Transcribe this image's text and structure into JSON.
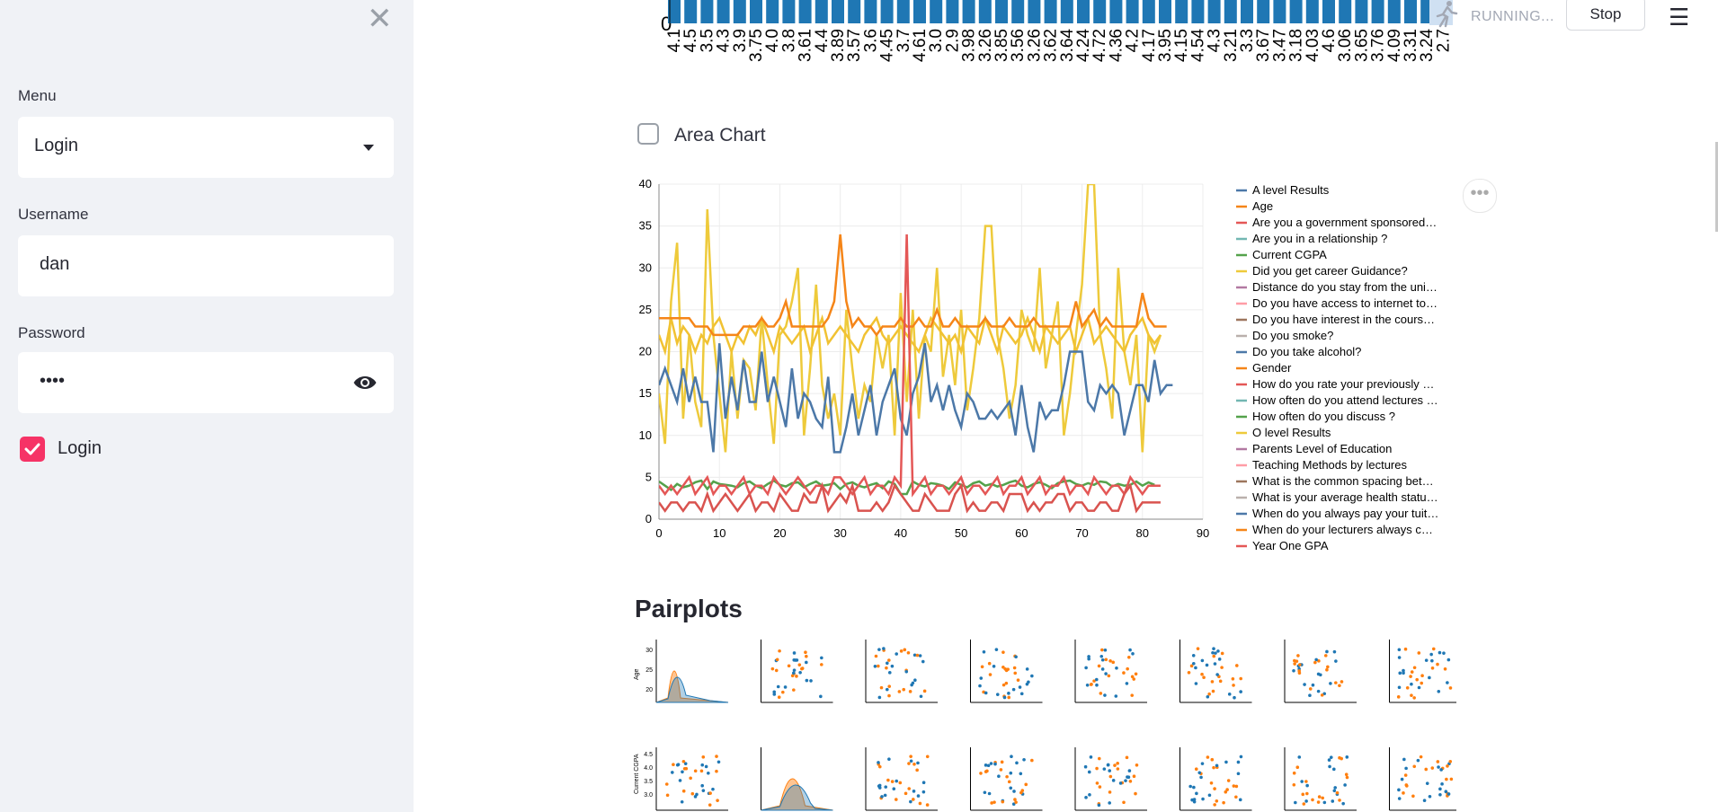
{
  "sidebar": {
    "close_icon": "close-icon",
    "menu_label": "Menu",
    "menu_value": "Login",
    "username_label": "Username",
    "username_value": "dan",
    "password_label": "Password",
    "password_masked": "••••",
    "login_checkbox_label": "Login",
    "login_checked": true,
    "accent_color": "#f63366"
  },
  "top_bar": {
    "status_text": "RUNNING...",
    "stop_label": "Stop",
    "menu_icon": "hamburger-icon"
  },
  "bar_chart_fragment": {
    "y_tick_zero": "0",
    "x_tick_labels": [
      "4.1",
      "4.5",
      "3.5",
      "4.3",
      "3.9",
      "3.75",
      "4.0",
      "3.8",
      "3.61",
      "4.4",
      "3.89",
      "3.57",
      "3.6",
      "4.45",
      "3.7",
      "4.61",
      "3.0",
      "2.9",
      "3.98",
      "3.26",
      "3.85",
      "3.56",
      "3.26",
      "3.62",
      "3.64",
      "4.24",
      "4.72",
      "4.36",
      "4.2",
      "4.17",
      "3.95",
      "4.15",
      "4.54",
      "4.3",
      "3.21",
      "3.3",
      "3.67",
      "3.47",
      "3.18",
      "4.03",
      "4.6",
      "3.06",
      "3.65",
      "3.76",
      "4.09",
      "3.31",
      "3.24",
      "2.7"
    ]
  },
  "area_chart": {
    "checkbox_label": "Area Chart",
    "checked": false
  },
  "chart_data": {
    "type": "line",
    "x_range": [
      0,
      90
    ],
    "y_range": [
      0,
      40
    ],
    "x_ticks": [
      0,
      10,
      20,
      30,
      40,
      50,
      60,
      70,
      80,
      90
    ],
    "y_ticks": [
      0,
      5,
      10,
      15,
      20,
      25,
      30,
      35,
      40
    ],
    "legend": [
      {
        "name": "A level Results",
        "color": "#4c78a8"
      },
      {
        "name": "Age",
        "color": "#f58518"
      },
      {
        "name": "Are you a government sponsored…",
        "color": "#e45756"
      },
      {
        "name": "Are you in a relationship ?",
        "color": "#72b7b2"
      },
      {
        "name": "Current CGPA",
        "color": "#54a24b"
      },
      {
        "name": "Did you get career Guidance?",
        "color": "#eeca3b"
      },
      {
        "name": "Distance do you stay from the uni…",
        "color": "#b279a2"
      },
      {
        "name": "Do you have access to internet to…",
        "color": "#ff9da6"
      },
      {
        "name": "Do you have interest in the cours…",
        "color": "#9d755d"
      },
      {
        "name": "Do you smoke?",
        "color": "#bab0ac"
      },
      {
        "name": "Do you take alcohol?",
        "color": "#4c78a8"
      },
      {
        "name": "Gender",
        "color": "#f58518"
      },
      {
        "name": "How do you rate your previously …",
        "color": "#e45756"
      },
      {
        "name": "How often do you attend lectures …",
        "color": "#72b7b2"
      },
      {
        "name": "How often do you discuss ?",
        "color": "#54a24b"
      },
      {
        "name": "O level Results",
        "color": "#eeca3b"
      },
      {
        "name": "Parents Level of Education",
        "color": "#b279a2"
      },
      {
        "name": "Teaching Methods by lectures",
        "color": "#ff9da6"
      },
      {
        "name": "What is the common spacing bet…",
        "color": "#9d755d"
      },
      {
        "name": "What is your average health statu…",
        "color": "#bab0ac"
      },
      {
        "name": "When do you always pay your tuit…",
        "color": "#4c78a8"
      },
      {
        "name": "When do your lecturers always c…",
        "color": "#f58518"
      },
      {
        "name": "Year One GPA",
        "color": "#e45756"
      }
    ],
    "series": [
      {
        "name": "O level Results",
        "color": "#eeca3b",
        "values": [
          15,
          9,
          26,
          33,
          12,
          22,
          14,
          11,
          37,
          22,
          15,
          8,
          20,
          12,
          19,
          18,
          13,
          24,
          16,
          9,
          22,
          23,
          26,
          30,
          10,
          18,
          28,
          16,
          12,
          15,
          10,
          25,
          18,
          12,
          16,
          14,
          22,
          18,
          22,
          10,
          27,
          14,
          25,
          12,
          22,
          20,
          30,
          17,
          22,
          16,
          25,
          13,
          18,
          24,
          35,
          35,
          22,
          18,
          12,
          16,
          25,
          22,
          20,
          30,
          18,
          22,
          26,
          10,
          15,
          22,
          28,
          40,
          40,
          22,
          18,
          12,
          30,
          20,
          16,
          22,
          8,
          22,
          20,
          22
        ]
      },
      {
        "name": "Did you get career Guidance?",
        "color": "#f1c232",
        "values": [
          22,
          20,
          24,
          21,
          23,
          22,
          20,
          22,
          21,
          23,
          24,
          22,
          20,
          22,
          21,
          23,
          22,
          24,
          22,
          20,
          23,
          22,
          21,
          22,
          23,
          20,
          22,
          24,
          21,
          22,
          23,
          22,
          21,
          20,
          22,
          23,
          24,
          22,
          21,
          22,
          23,
          22,
          21,
          20,
          22,
          24,
          23,
          22,
          21,
          22,
          20,
          23,
          22,
          21,
          24,
          22,
          20,
          23,
          22,
          21,
          22,
          24,
          22,
          20,
          23,
          22,
          21,
          22,
          23,
          20,
          22,
          24,
          21,
          22,
          23,
          22,
          21,
          20,
          22,
          23,
          24,
          22,
          21,
          22
        ]
      },
      {
        "name": "Age",
        "color": "#f58518",
        "values": [
          24,
          24,
          24,
          24,
          24,
          24,
          23,
          23,
          23,
          22,
          22,
          22,
          22,
          22,
          23,
          23,
          23,
          24,
          23,
          23,
          24,
          26,
          23,
          23,
          23,
          23,
          23,
          23,
          24,
          26,
          34,
          26,
          23,
          24,
          23,
          23,
          22,
          23,
          23,
          23,
          24,
          23,
          23,
          24,
          23,
          23,
          25,
          23,
          23,
          24,
          23,
          23,
          23,
          23,
          24,
          23,
          23,
          23,
          24,
          23,
          23,
          23,
          24,
          23,
          23,
          23,
          23,
          23,
          23,
          26,
          23,
          24,
          25,
          23,
          24,
          23,
          23,
          23,
          23,
          23,
          27,
          24,
          23,
          23,
          23
        ]
      },
      {
        "name": "A level Results",
        "color": "#4c78a8",
        "values": [
          16,
          18,
          16,
          14,
          18,
          14,
          17,
          14,
          14,
          8,
          21,
          12,
          17,
          13,
          19,
          14,
          14,
          20,
          14,
          17,
          14,
          11,
          18,
          12,
          15,
          14,
          12,
          11,
          17,
          8,
          8,
          11,
          15,
          10,
          13,
          16,
          10,
          14,
          16,
          18,
          12,
          10,
          15,
          17,
          21,
          14,
          16,
          13,
          16,
          13,
          11,
          15,
          14,
          12,
          12,
          13,
          12,
          13,
          14,
          10,
          16,
          11,
          8,
          14,
          12,
          13,
          13,
          16,
          20,
          20,
          20,
          14,
          13,
          16,
          15,
          16,
          15,
          10,
          13,
          16,
          16,
          14,
          19,
          15,
          16,
          16
        ]
      },
      {
        "name": "Current CGPA",
        "color": "#54a24b",
        "values": [
          4.5,
          4,
          3.5,
          4.2,
          3.8,
          4,
          4.4,
          4.6,
          3.6,
          4.5,
          4.2,
          4.1,
          4,
          3.8,
          4.3,
          4.5,
          4,
          3.7,
          4.2,
          4.6,
          4.1,
          3.9,
          4.3,
          4.4,
          3.8,
          4.2,
          4.5,
          4,
          4.1,
          4.3,
          3.6,
          4.2,
          4.4,
          4,
          3.8,
          4.1,
          4.3,
          3.7,
          4.5,
          4.2,
          3,
          3,
          4.5,
          4.1,
          3.9,
          4.3,
          4.2,
          4,
          3.6,
          4.4,
          4.1,
          3.8,
          4.3,
          4.5,
          4,
          4.2,
          3.9,
          4.1,
          4.4,
          4.6,
          4,
          3.8,
          4.2,
          4.4,
          4.1,
          3.7,
          4.3,
          4.5,
          4.6,
          4.2,
          4,
          4.3,
          4.1,
          4.5,
          4.4,
          3.9,
          4.2,
          4,
          4.1,
          4.5,
          4,
          4.4,
          4.1
        ]
      },
      {
        "name": "How do you rate your previously …",
        "color": "#e45756",
        "values": [
          4,
          3,
          4,
          3,
          4,
          5,
          3,
          4,
          5,
          3,
          4,
          4,
          3,
          4,
          5,
          3,
          4,
          4,
          3,
          5,
          4,
          3,
          4,
          5,
          4,
          3,
          4,
          4,
          3,
          5,
          5,
          4,
          3,
          4,
          5,
          3,
          4,
          4,
          3,
          5,
          4,
          34,
          3,
          4,
          5,
          3,
          4,
          4,
          3,
          4,
          5,
          3,
          4,
          4,
          3,
          4,
          5,
          3,
          4,
          4,
          5,
          3,
          4,
          5,
          3,
          4,
          4,
          5,
          3,
          4,
          4,
          3,
          5,
          4,
          3,
          4,
          4,
          3,
          5,
          4,
          3,
          4,
          4,
          4
        ]
      },
      {
        "name": "Year One GPA",
        "color": "#d9534f",
        "values": [
          2,
          1,
          2,
          2,
          1,
          2,
          2,
          1,
          3,
          1,
          2,
          3,
          2,
          1,
          2,
          3,
          1,
          2,
          2,
          1,
          3,
          2,
          1,
          1,
          3,
          2,
          2,
          4,
          1,
          2,
          3,
          2,
          4,
          1,
          1,
          1,
          2,
          1,
          2,
          4,
          3,
          2,
          1,
          1,
          3,
          2,
          1,
          1,
          1,
          3,
          4,
          1,
          2,
          1,
          1,
          2,
          2,
          1,
          3,
          3,
          3,
          1,
          2,
          1,
          2,
          2,
          3,
          3,
          1,
          2,
          2,
          1,
          1,
          2,
          2,
          1,
          1,
          3,
          4,
          1,
          2,
          2,
          2,
          2
        ]
      }
    ]
  },
  "pairplots": {
    "title": "Pairplots",
    "row1_ylabel": "Age",
    "row1_yticks": [
      "30",
      "25",
      "20"
    ],
    "row2_ylabel": "Current CGPA",
    "row2_yticks": [
      "4.5",
      "4.0",
      "3.5",
      "3.0"
    ],
    "colors": [
      "#1f77b4",
      "#ff7f0e"
    ]
  },
  "chart_menu_icon": "more-horizontal-icon"
}
